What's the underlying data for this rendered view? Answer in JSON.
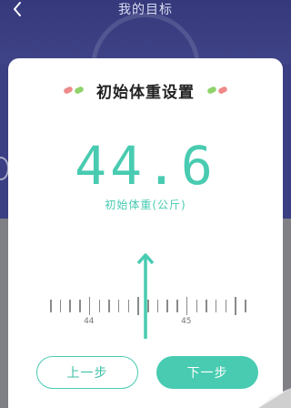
{
  "header": {
    "title": "我的目标",
    "back_icon": "chevron-left-icon"
  },
  "card": {
    "title": "初始体重设置",
    "weight_value": "44.6",
    "weight_label": "初始体重(公斤)",
    "ruler": {
      "labels": [
        "44",
        "45"
      ],
      "selected_value": 44.6,
      "range": [
        43.6,
        45.6
      ],
      "step": 0.1
    },
    "prev_button": "上一步",
    "next_button": "下一步"
  },
  "colors": {
    "accent": "#48cbb1",
    "header_bg": "#3a3e82",
    "pill_red": "#ef8a8a",
    "pill_green": "#8fd36a"
  }
}
